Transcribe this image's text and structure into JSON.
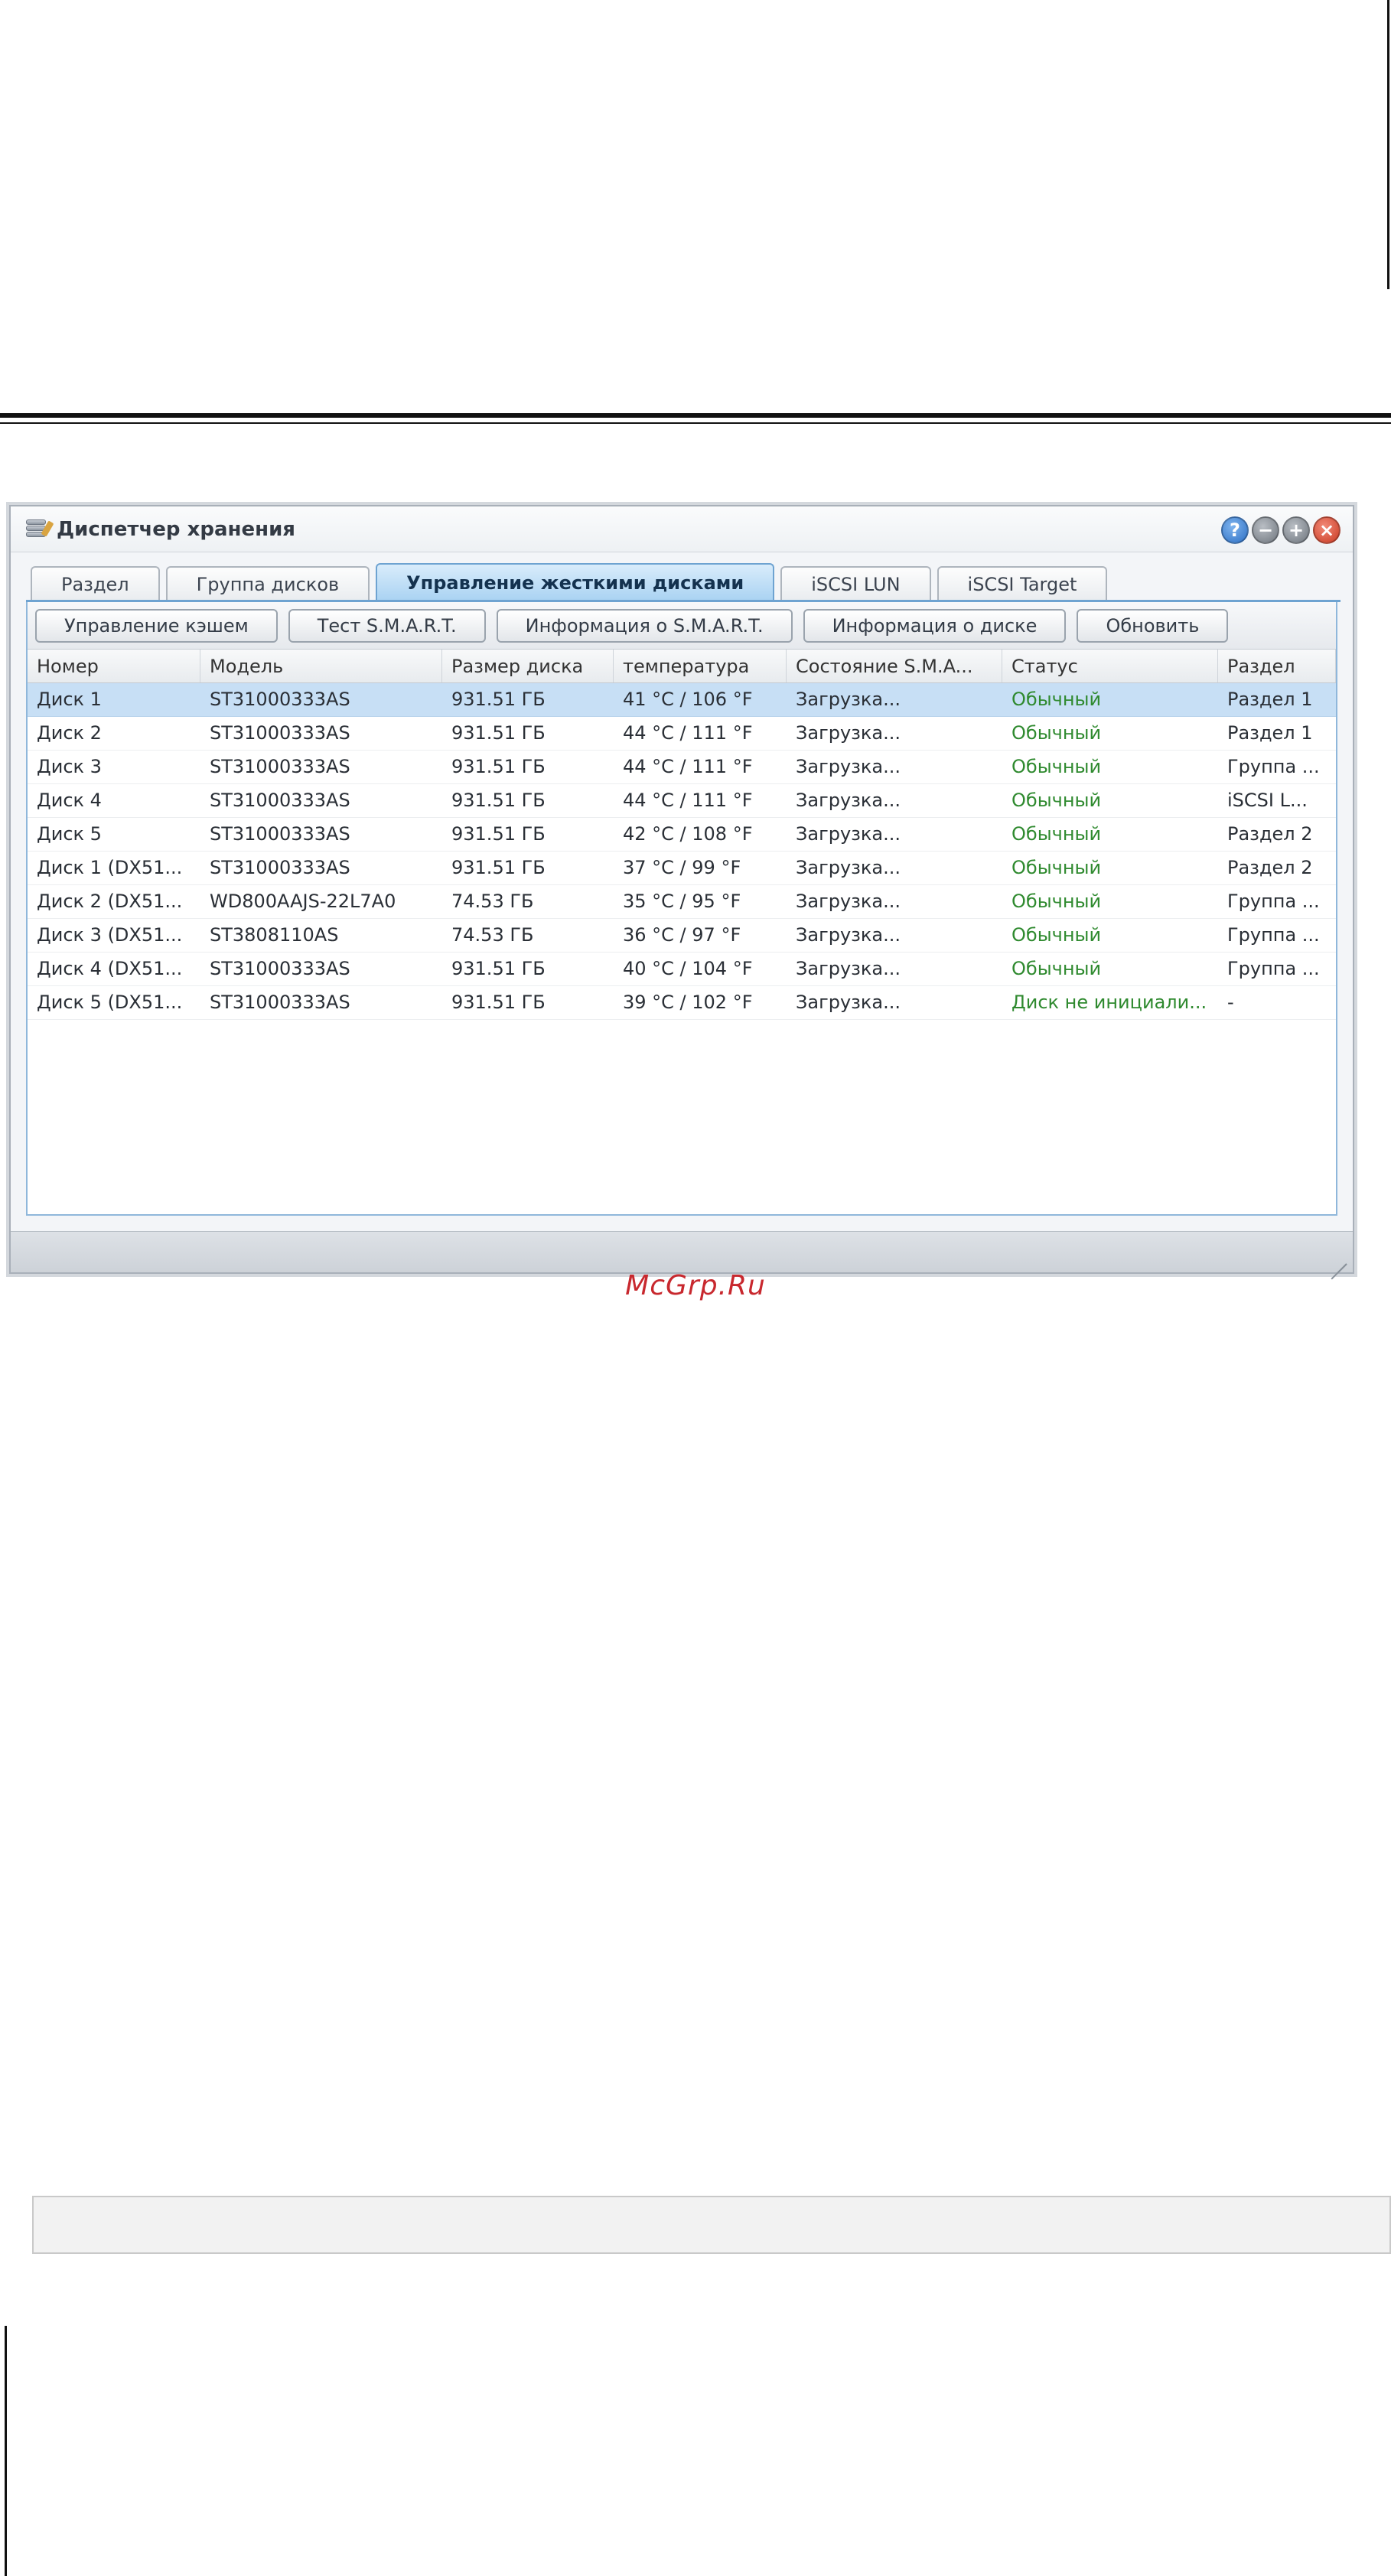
{
  "window": {
    "title": "Диспетчер хранения"
  },
  "tabs": [
    {
      "label": "Раздел",
      "active": false
    },
    {
      "label": "Группа дисков",
      "active": false
    },
    {
      "label": "Управление жесткими дисками",
      "active": true
    },
    {
      "label": "iSCSI LUN",
      "active": false
    },
    {
      "label": "iSCSI Target",
      "active": false
    }
  ],
  "toolbar": {
    "cache_label": "Управление кэшем",
    "smart_test_label": "Тест S.M.A.R.T.",
    "smart_info_label": "Информация о S.M.A.R.T.",
    "disk_info_label": "Информация о диске",
    "refresh_label": "Обновить"
  },
  "table": {
    "columns": [
      "Номер",
      "Модель",
      "Размер диска",
      "температура",
      "Состояние S.M.A...",
      "Статус",
      "Раздел"
    ],
    "rows": [
      {
        "num": "Диск 1",
        "model": "ST31000333AS",
        "size": "931.51 ГБ",
        "temp": "41 °C / 106 °F",
        "smart": "Загрузка...",
        "status": "Обычный",
        "volume": "Раздел 1"
      },
      {
        "num": "Диск 2",
        "model": "ST31000333AS",
        "size": "931.51 ГБ",
        "temp": "44 °C / 111 °F",
        "smart": "Загрузка...",
        "status": "Обычный",
        "volume": "Раздел 1"
      },
      {
        "num": "Диск 3",
        "model": "ST31000333AS",
        "size": "931.51 ГБ",
        "temp": "44 °C / 111 °F",
        "smart": "Загрузка...",
        "status": "Обычный",
        "volume": "Группа ..."
      },
      {
        "num": "Диск 4",
        "model": "ST31000333AS",
        "size": "931.51 ГБ",
        "temp": "44 °C / 111 °F",
        "smart": "Загрузка...",
        "status": "Обычный",
        "volume": "iSCSI L..."
      },
      {
        "num": "Диск 5",
        "model": "ST31000333AS",
        "size": "931.51 ГБ",
        "temp": "42 °C / 108 °F",
        "smart": "Загрузка...",
        "status": "Обычный",
        "volume": "Раздел 2"
      },
      {
        "num": "Диск 1 (DX51...",
        "model": "ST31000333AS",
        "size": "931.51 ГБ",
        "temp": "37 °C / 99 °F",
        "smart": "Загрузка...",
        "status": "Обычный",
        "volume": "Раздел 2"
      },
      {
        "num": "Диск 2 (DX51...",
        "model": "WD800AAJS-22L7A0",
        "size": "74.53 ГБ",
        "temp": "35 °C / 95 °F",
        "smart": "Загрузка...",
        "status": "Обычный",
        "volume": "Группа ..."
      },
      {
        "num": "Диск 3 (DX51...",
        "model": "ST3808110AS",
        "size": "74.53 ГБ",
        "temp": "36 °C / 97 °F",
        "smart": "Загрузка...",
        "status": "Обычный",
        "volume": "Группа ..."
      },
      {
        "num": "Диск 4 (DX51...",
        "model": "ST31000333AS",
        "size": "931.51 ГБ",
        "temp": "40 °C / 104 °F",
        "smart": "Загрузка...",
        "status": "Обычный",
        "volume": "Группа ..."
      },
      {
        "num": "Диск 5 (DX51...",
        "model": "ST31000333AS",
        "size": "931.51 ГБ",
        "temp": "39 °C / 102 °F",
        "smart": "Загрузка...",
        "status": "Диск не инициали...",
        "volume": "-"
      }
    ]
  },
  "watermark": "McGrp.Ru",
  "colors": {
    "status_ok": "#2f8a2f",
    "selected_row": "#c7dff5",
    "close_button": "#c93a22",
    "help_button": "#2c6fc4"
  },
  "icons": {
    "help": "?",
    "minimize": "−",
    "maximize": "+",
    "close": "×"
  }
}
